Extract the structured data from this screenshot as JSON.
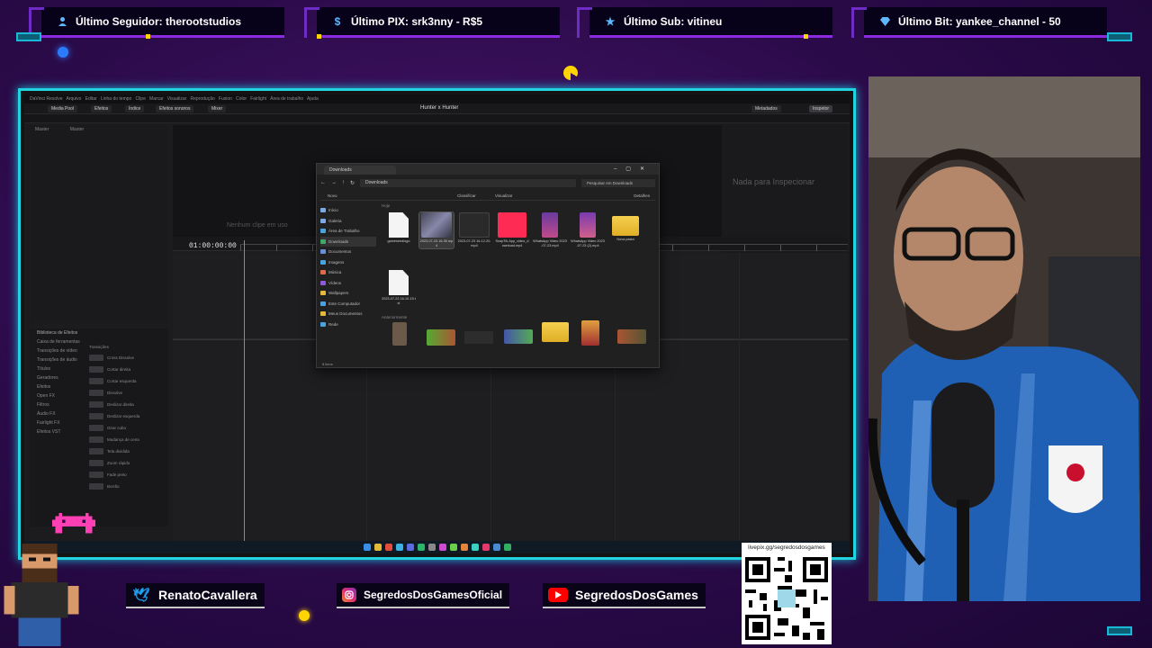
{
  "alerts": [
    {
      "label": "Último Seguidor: therootstudios",
      "icon": "user-icon"
    },
    {
      "label": "Último PIX: srk3nny - R$5",
      "icon": "dollar-icon"
    },
    {
      "label": "Último Sub: vitineu",
      "icon": "star-icon"
    },
    {
      "label": "Último Bit: yankee_channel - 50",
      "icon": "diamond-icon"
    }
  ],
  "app": {
    "project_title": "Hunter x Hunter",
    "timecode": "01:00:00:00",
    "inspector_empty": "Nada para Inspecionar",
    "viewer_empty": "Nenhum clipe em uso",
    "toolbar": [
      "Media Pool",
      "Efeitos",
      "Índice",
      "Efeitos sonoros",
      "Mixer"
    ],
    "toolbar_right": [
      "Metadados",
      "Inspetor"
    ],
    "bins_title": "Biblioteca de Efeitos",
    "bins": [
      "Caixa de ferramentas",
      "Transições de vídeo",
      "Transições de áudio",
      "Títulos",
      "Geradores",
      "Efeitos",
      "Open FX",
      "Filtros",
      "Áudio FX",
      "Fairlight FX",
      "Efeitos VST"
    ],
    "effects_header": "Transições",
    "effects": [
      "Cross Dissolve",
      "Cortar direita",
      "Cortar esquerda",
      "Dissolve",
      "Deslizar direita",
      "Deslizar esquerda",
      "Girar cubo",
      "Mudança de cena",
      "Tela dividida",
      "Zoom rápido",
      "Fade preto",
      "Borrão"
    ]
  },
  "explorer": {
    "tab": "Downloads",
    "path": "Downloads",
    "search": "Pesquisar em Downloads",
    "commands": [
      "Novo",
      "Classificar",
      "Visualizar",
      "Detalhes"
    ],
    "nav": [
      "Início",
      "Galeria",
      "Área de Trabalho",
      "Downloads",
      "Documentos",
      "Imagens",
      "Música",
      "Vídeos",
      "Wallpapers",
      "Este Computador",
      "Meus Documentos",
      "Rede"
    ],
    "section_today": "Hoje",
    "section_earlier": "Anteriormente",
    "files": [
      {
        "name": "gameseedlogo"
      },
      {
        "name": "2023-07-23 16-30.mp4"
      },
      {
        "name": "2023-07-23 16-12-20.mp4"
      },
      {
        "name": "SnapTik.App_video_download.mp4"
      },
      {
        "name": "WhatsApp Video 2023-07-23.mp4"
      },
      {
        "name": "WhatsApp Video 2023-07-23 (2).mp4"
      },
      {
        "name": "Nova pasta"
      },
      {
        "name": "2023-07-23 16-10-15.txt"
      }
    ],
    "status": "8 itens"
  },
  "social": [
    {
      "label": "RenatoCavallera",
      "icon": "twitter-icon",
      "color": "#1da1f2"
    },
    {
      "label": "SegredosDosGamesOficial",
      "icon": "instagram-icon",
      "color": "#c13584"
    },
    {
      "label": "SegredosDosGames",
      "icon": "youtube-icon",
      "color": "#ff0000"
    }
  ],
  "qr_url": "livepix.gg/segredosdosgames",
  "colors": {
    "accent": "#21d4e0",
    "frame_purple": "#8a2be2",
    "gold": "#ffd400"
  }
}
